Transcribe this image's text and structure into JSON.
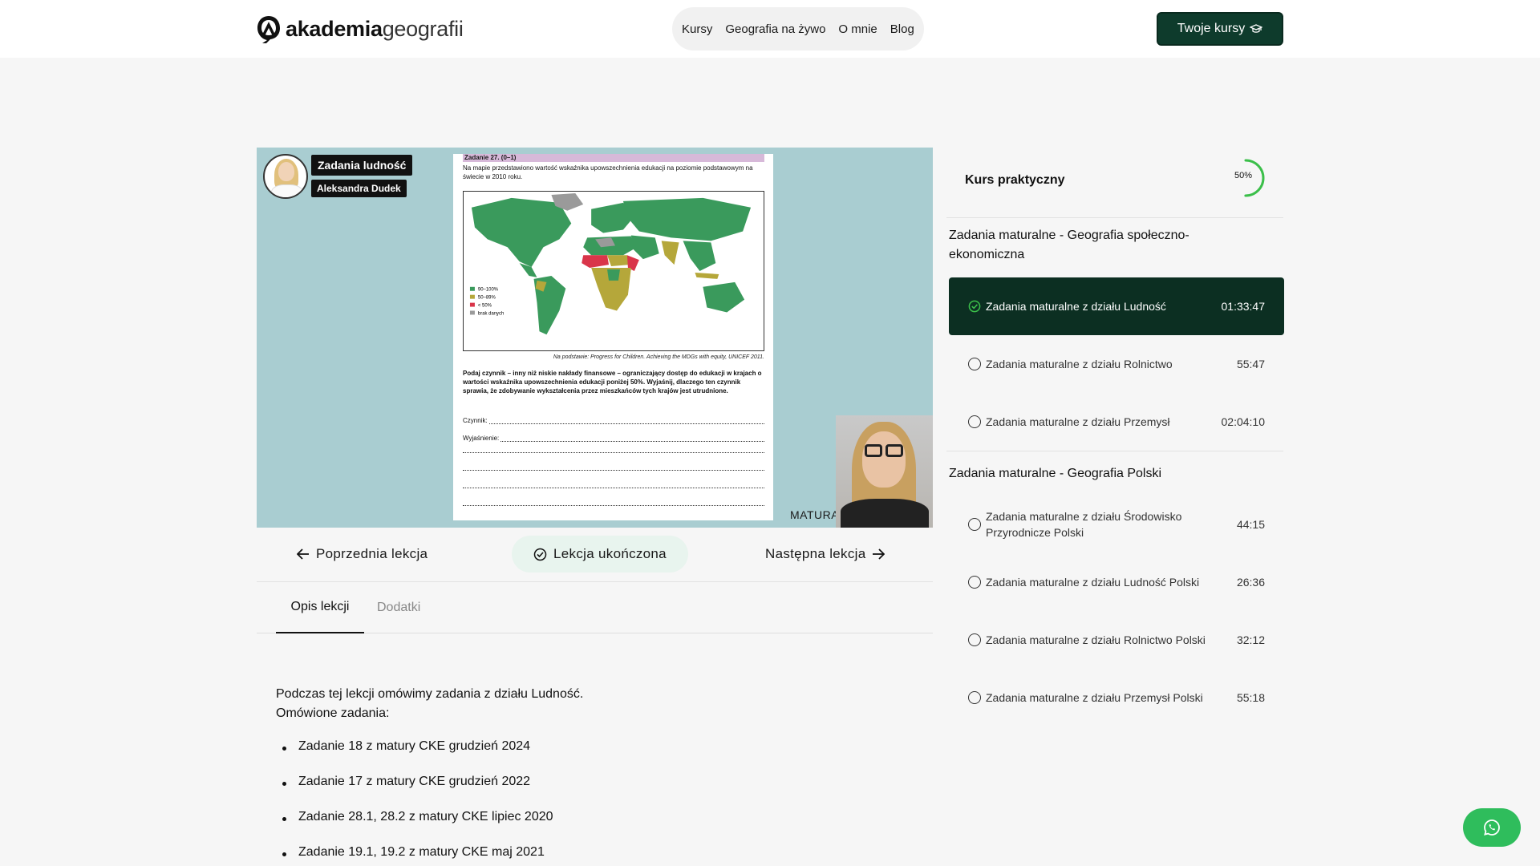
{
  "header": {
    "logo_bold": "akademia",
    "logo_light": "geografii",
    "nav": [
      "Kursy",
      "Geografia na żywo",
      "O mnie",
      "Blog"
    ],
    "cta_label": "Twoje kursy",
    "cta_icon": "graduation-cap-icon"
  },
  "video": {
    "tag_title": "Zadania ludność",
    "tag_author": "Aleksandra Dudek",
    "sheet_header": "Zadanie 27. (0–1)",
    "sheet_intro": "Na mapie przedstawiono wartość wskaźnika upowszechnienia edukacji na poziomie podstawowym na świecie w 2010 roku.",
    "legend": [
      "90–100%",
      "50–89%",
      "< 50%",
      "brak danych"
    ],
    "legend_colors": [
      "#3a9a5c",
      "#b5a73a",
      "#d9354a",
      "#9a9a9a"
    ],
    "source": "Na podstawie: Progress for Children. Achieving the MDGs with equity, UNICEF 2011.",
    "question": "Podaj czynnik – inny niż niskie nakłady finansowe – ograniczający dostęp do edukacji w krajach o wartości wskaźnika upowszechnienia edukacji poniżej 50%. Wyjaśnij, dlaczego ten czynnik sprawia, że zdobywanie wykształcenia przez mieszkańców tych krajów jest utrudnione.",
    "field1": "Czynnik:",
    "field2": "Wyjaśnienie:",
    "watermark": "MATURA"
  },
  "controls": {
    "prev": "Poprzednia lekcja",
    "done": "Lekcja ukończona",
    "next": "Następna lekcja"
  },
  "tabs": [
    "Opis lekcji",
    "Dodatki"
  ],
  "description": {
    "line1": "Podczas tej lekcji omówimy zadania z działu Ludność.",
    "line2": "Omówione zadania:",
    "items": [
      "Zadanie 18 z matury CKE grudzień 2024",
      "Zadanie 17 z matury CKE grudzień 2022",
      "Zadanie 28.1, 28.2 z matury CKE lipiec 2020",
      "Zadanie 19.1, 19.2 z matury CKE maj 2021"
    ]
  },
  "sidebar": {
    "course_title": "Kurs praktyczny",
    "progress_label": "50%",
    "progress": 0.5,
    "accent": "#3bbf4a",
    "sections": [
      {
        "title": "Zadania maturalne - Geografia społeczno-ekonomiczna",
        "lessons": [
          {
            "label": "Zadania maturalne z działu Ludność",
            "duration": "01:33:47",
            "done": true
          },
          {
            "label": "Zadania maturalne z działu Rolnictwo",
            "duration": "55:47",
            "done": false
          },
          {
            "label": "Zadania maturalne z działu Przemysł",
            "duration": "02:04:10",
            "done": false
          }
        ]
      },
      {
        "title": "Zadania maturalne - Geografia Polski",
        "lessons": [
          {
            "label": "Zadania maturalne z działu Środowisko Przyrodnicze Polski",
            "duration": "44:15",
            "done": false
          },
          {
            "label": "Zadania maturalne z działu Ludność Polski",
            "duration": "26:36",
            "done": false
          },
          {
            "label": "Zadania maturalne z działu Rolnictwo Polski",
            "duration": "32:12",
            "done": false
          },
          {
            "label": "Zadania maturalne z działu Przemysł Polski",
            "duration": "55:18",
            "done": false
          }
        ]
      }
    ]
  },
  "whatsapp_icon": "whatsapp-icon"
}
